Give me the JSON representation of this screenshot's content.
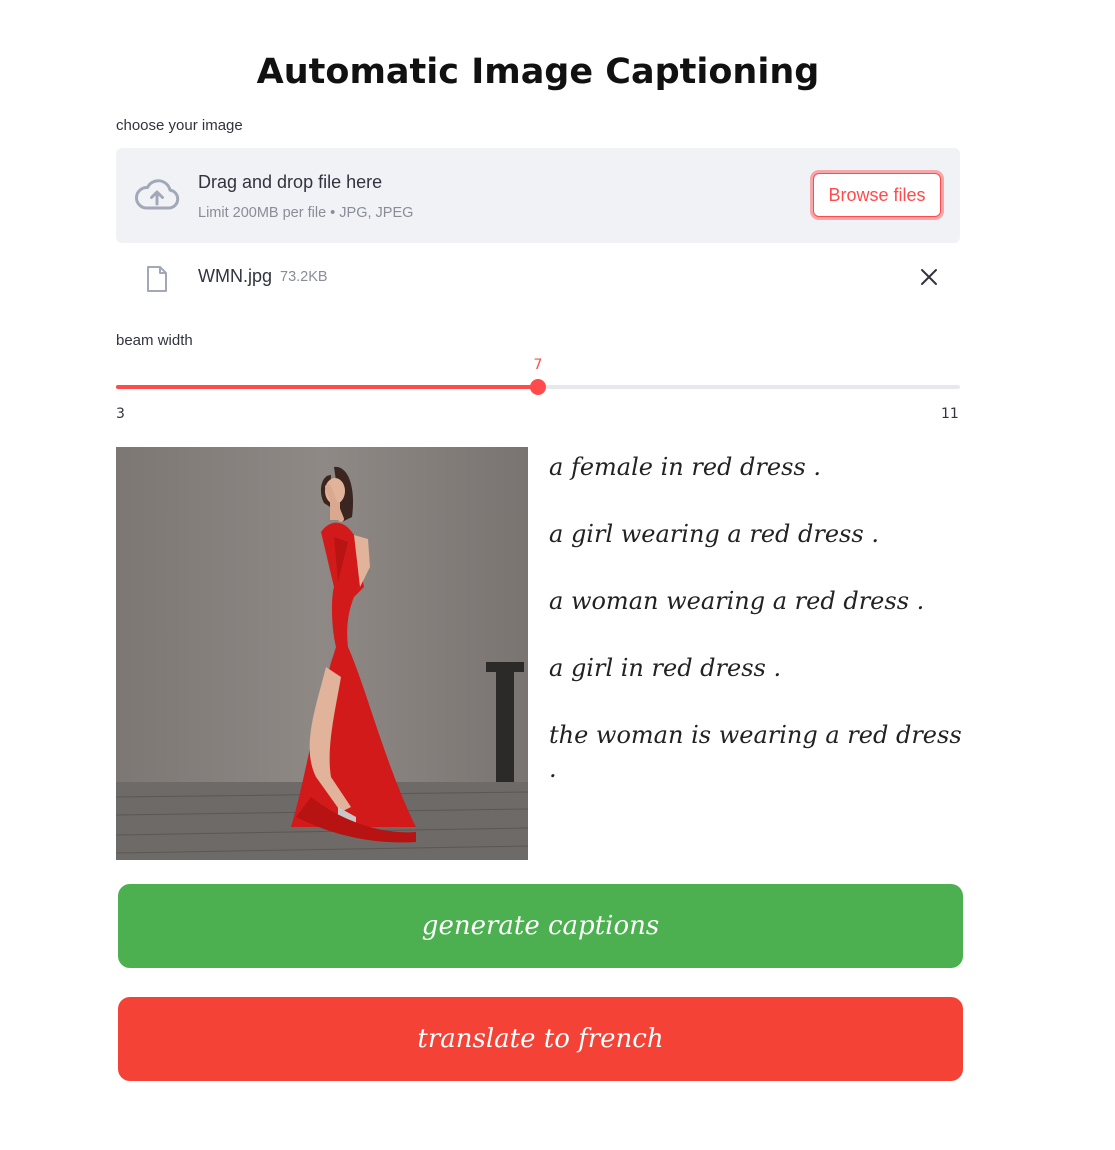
{
  "page": {
    "title": "Automatic Image Captioning"
  },
  "uploader": {
    "label": "choose your image",
    "drop_text": "Drag and drop file here",
    "limit_text": "Limit 200MB per file • JPG, JPEG",
    "browse_label": "Browse files",
    "file": {
      "name": "WMN.jpg",
      "size": "73.2KB"
    }
  },
  "slider": {
    "label": "beam width",
    "value": 7,
    "min": 3,
    "max": 11,
    "value_text": "7",
    "min_text": "3",
    "max_text": "11"
  },
  "captions": [
    "a female in red dress .",
    "a girl wearing a red dress .",
    "a woman wearing a red dress .",
    "a girl in red dress .",
    "the woman is wearing a red dress ."
  ],
  "buttons": {
    "generate": "generate captions",
    "translate": "translate to french"
  },
  "colors": {
    "accent": "#ff4b4b",
    "generate_bg": "#4caf50",
    "translate_bg": "#f44336"
  }
}
